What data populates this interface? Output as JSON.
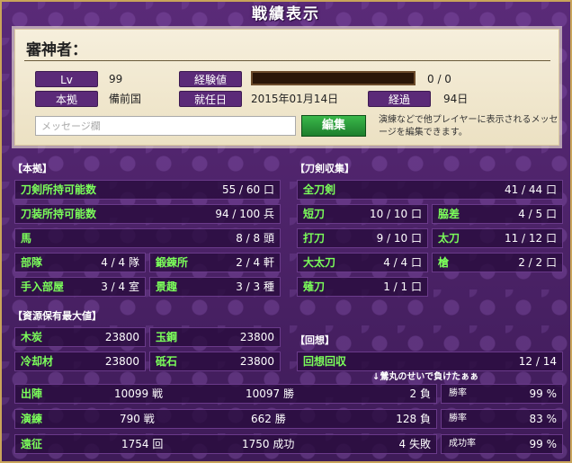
{
  "title": "戦績表示",
  "profile": {
    "shinsha_label": "審神者：",
    "lv_label": "Lv",
    "lv_value": "99",
    "exp_label": "経験値",
    "exp_value": "0 / 0",
    "exp_fraction": 0,
    "base_label": "本拠",
    "base_value": "備前国",
    "appointed_label": "就任日",
    "appointed_value": "2015年01月14日",
    "elapsed_label": "経過",
    "elapsed_value": "94日",
    "message_placeholder": "メッセージ欄",
    "edit_label": "編集",
    "note": "演練などで他プレイヤーに表示されるメッセージを編集できます。"
  },
  "honkyo": {
    "header": "【本拠】",
    "rows": [
      {
        "label": "刀剣所持可能数",
        "value": "55 / 60 口"
      },
      {
        "label": "刀装所持可能数",
        "value": "94 / 100 兵"
      },
      {
        "label": "馬",
        "value": "8 / 8 頭"
      }
    ],
    "pairs": [
      [
        {
          "label": "部隊",
          "value": "4 / 4 隊"
        },
        {
          "label": "鍛錬所",
          "value": "2 / 4 軒"
        }
      ],
      [
        {
          "label": "手入部屋",
          "value": "3 / 4 室"
        },
        {
          "label": "景趣",
          "value": "3 / 3 種"
        }
      ]
    ]
  },
  "touken": {
    "header": "【刀剣収集】",
    "total": {
      "label": "全刀剣",
      "value": "41 / 44 口"
    },
    "pairs": [
      [
        {
          "label": "短刀",
          "value": "10 / 10 口"
        },
        {
          "label": "脇差",
          "value": "4 / 5 口"
        }
      ],
      [
        {
          "label": "打刀",
          "value": "9 / 10 口"
        },
        {
          "label": "太刀",
          "value": "11 / 12 口"
        }
      ],
      [
        {
          "label": "大太刀",
          "value": "4 / 4 口"
        },
        {
          "label": "槍",
          "value": "2 / 2 口"
        }
      ]
    ],
    "naginata": {
      "label": "薙刀",
      "value": "1 / 1 口"
    }
  },
  "resources": {
    "header": "【資源保有最大値】",
    "items": [
      [
        {
          "label": "木炭",
          "value": "23800"
        },
        {
          "label": "玉鋼",
          "value": "23800"
        }
      ],
      [
        {
          "label": "冷却材",
          "value": "23800"
        },
        {
          "label": "砥石",
          "value": "23800"
        }
      ]
    ]
  },
  "kaisou": {
    "header": "【回想】",
    "row": {
      "label": "回想回収",
      "value": "12 / 14"
    }
  },
  "annotation": "↓鶯丸のせいで負けたぁぁ",
  "battles": [
    {
      "label": "出陣",
      "a": "10099 戦",
      "b": "10097 勝",
      "c": "2 負",
      "rate_label": "勝率",
      "rate": "99 %"
    },
    {
      "label": "演練",
      "a": "790 戦",
      "b": "662 勝",
      "c": "128 負",
      "rate_label": "勝率",
      "rate": "83 %"
    },
    {
      "label": "遠征",
      "a": "1754 回",
      "b": "1750 成功",
      "c": "4 失敗",
      "rate_label": "成功率",
      "rate": "99 %"
    }
  ],
  "colors": {
    "label_green": "#7bff5a",
    "panel_purple": "#5b2a78",
    "edit_green": "#2a9a3a"
  }
}
